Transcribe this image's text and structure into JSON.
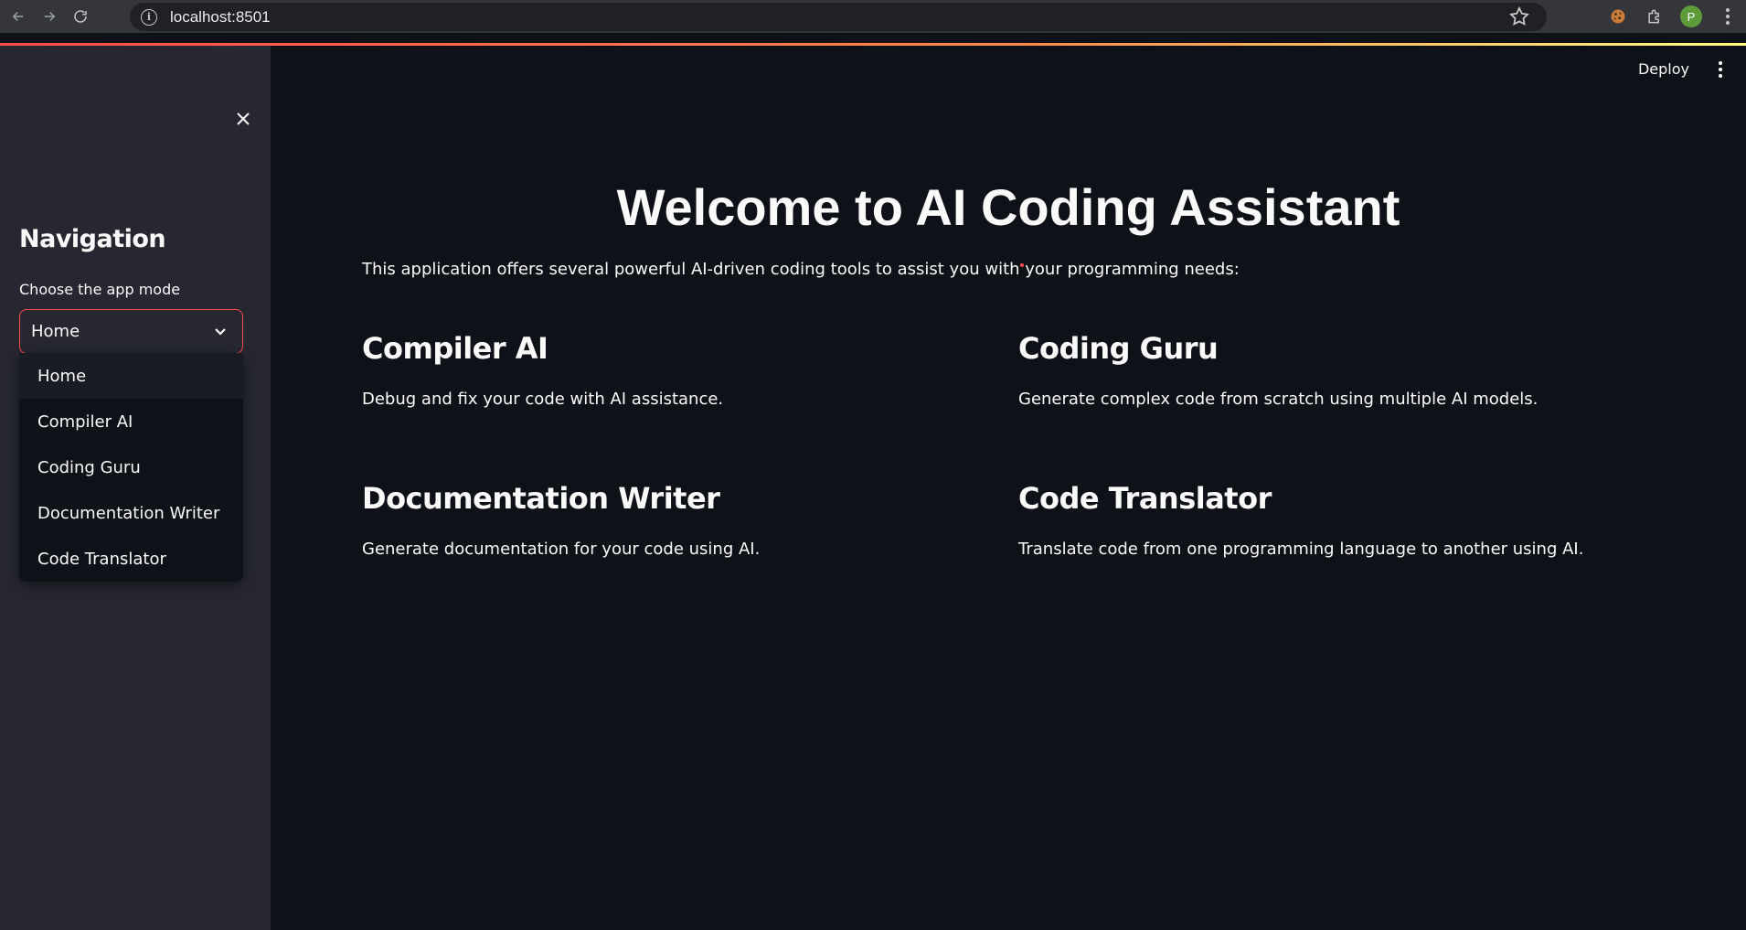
{
  "browser": {
    "url": "localhost:8501",
    "avatar_letter": "P"
  },
  "sidebar": {
    "title": "Navigation",
    "select_label": "Choose the app mode",
    "selected_value": "Home",
    "options": [
      "Home",
      "Compiler AI",
      "Coding Guru",
      "Documentation Writer",
      "Code Translator"
    ]
  },
  "header": {
    "deploy_label": "Deploy"
  },
  "main": {
    "title": "Welcome to AI Coding Assistant",
    "intro": "This application offers several powerful AI-driven coding tools to assist you with your programming needs:",
    "features": [
      {
        "title": "Compiler AI",
        "description": "Debug and fix your code with AI assistance."
      },
      {
        "title": "Coding Guru",
        "description": "Generate complex code from scratch using multiple AI models."
      },
      {
        "title": "Documentation Writer",
        "description": "Generate documentation for your code using AI."
      },
      {
        "title": "Code Translator",
        "description": "Translate code from one programming language to another using AI."
      }
    ]
  },
  "colors": {
    "accent": "#ff4b4b",
    "background": "#0e1117",
    "sidebar": "#262730",
    "text": "#fafafa"
  }
}
